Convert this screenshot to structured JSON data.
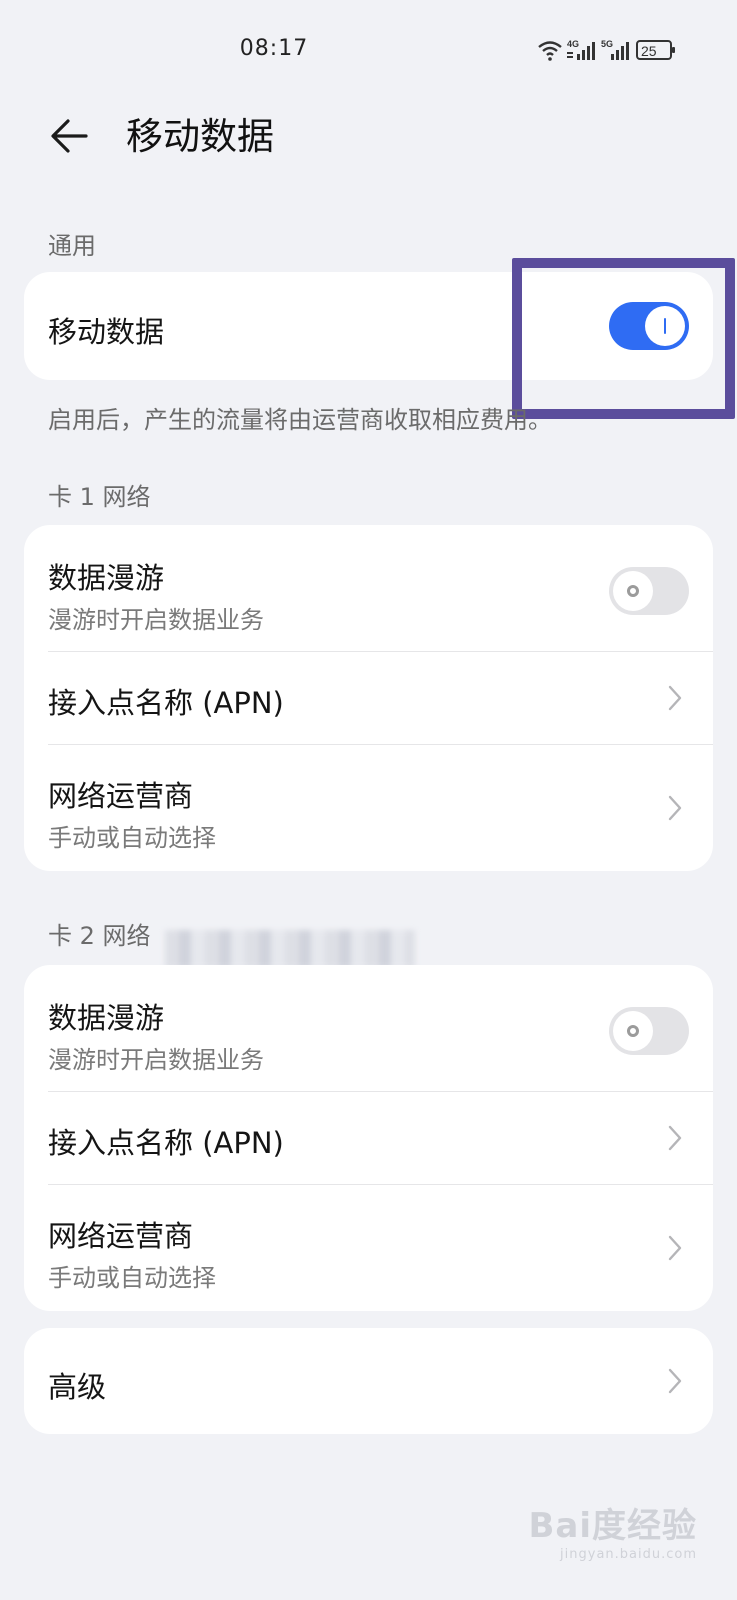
{
  "status_bar": {
    "time": "08:17",
    "network1": "4G",
    "network2": "5G",
    "battery": "25",
    "icons": [
      "wifi-icon",
      "signal-4g-icon",
      "signal-5g-icon",
      "battery-icon"
    ]
  },
  "header": {
    "title": "移动数据",
    "back_icon": "arrow-left-icon"
  },
  "general": {
    "label": "通用",
    "mobile_data": {
      "title": "移动数据",
      "enabled": true
    },
    "note": "启用后，产生的流量将由运营商收取相应费用。"
  },
  "sim1": {
    "label": "卡 1 网络",
    "roaming": {
      "title": "数据漫游",
      "subtitle": "漫游时开启数据业务",
      "enabled": false
    },
    "apn": {
      "title": "接入点名称 (APN)"
    },
    "carrier": {
      "title": "网络运营商",
      "subtitle": "手动或自动选择"
    }
  },
  "sim2": {
    "label": "卡 2 网络",
    "roaming": {
      "title": "数据漫游",
      "subtitle": "漫游时开启数据业务",
      "enabled": false
    },
    "apn": {
      "title": "接入点名称 (APN)"
    },
    "carrier": {
      "title": "网络运营商",
      "subtitle": "手动或自动选择"
    }
  },
  "advanced": {
    "title": "高级"
  },
  "watermark": {
    "main": "Bai度经验",
    "sub": "jingyan.baidu.com"
  },
  "colors": {
    "accent": "#2f6cf3",
    "background": "#f1f2f6",
    "card": "#ffffff",
    "highlight": "#5b4d9c"
  }
}
